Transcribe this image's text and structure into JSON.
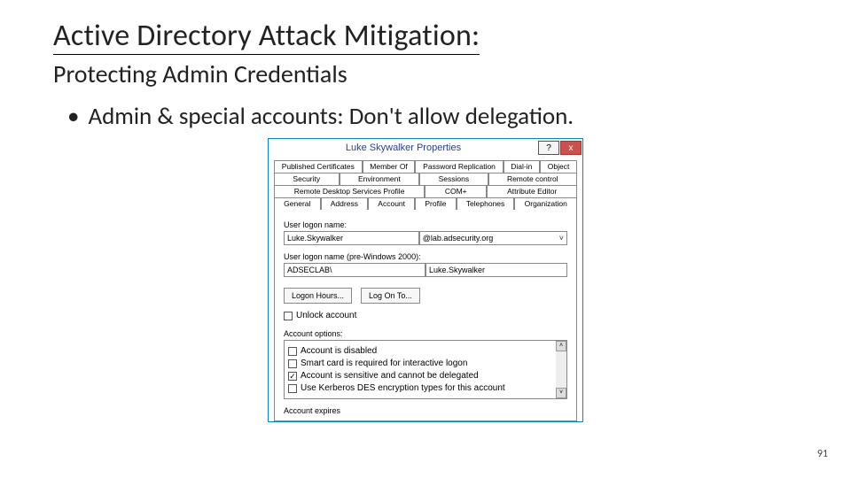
{
  "slide": {
    "title": "Active Directory Attack Mitigation:",
    "subtitle": "Protecting Admin Credentials",
    "bullet": "Admin & special accounts: Don't allow delegation.",
    "page_number": "91"
  },
  "dialog": {
    "title": "Luke Skywalker Properties",
    "help": "?",
    "close": "x",
    "tabs": {
      "row1": [
        "Published Certificates",
        "Member Of",
        "Password Replication",
        "Dial-in",
        "Object"
      ],
      "row2": [
        "Security",
        "Environment",
        "Sessions",
        "Remote control"
      ],
      "row3": [
        "Remote Desktop Services Profile",
        "COM+",
        "Attribute Editor"
      ],
      "row4": [
        "General",
        "Address",
        "Account",
        "Profile",
        "Telephones",
        "Organization"
      ]
    },
    "logon_label": "User logon name:",
    "logon_name": "Luke.Skywalker",
    "domain": "@lab.adsecurity.org",
    "pre2000_label": "User logon name (pre-Windows 2000):",
    "pre_domain": "ADSECLAB\\",
    "pre_user": "Luke.Skywalker",
    "btn_hours": "Logon Hours...",
    "btn_logonto": "Log On To...",
    "unlock": "Unlock account",
    "options_label": "Account options:",
    "opts": {
      "o1": "Account is disabled",
      "o2": "Smart card is required for interactive logon",
      "o3": "Account is sensitive and cannot be delegated",
      "o4": "Use Kerberos DES encryption types for this account"
    },
    "expires_label": "Account expires"
  }
}
